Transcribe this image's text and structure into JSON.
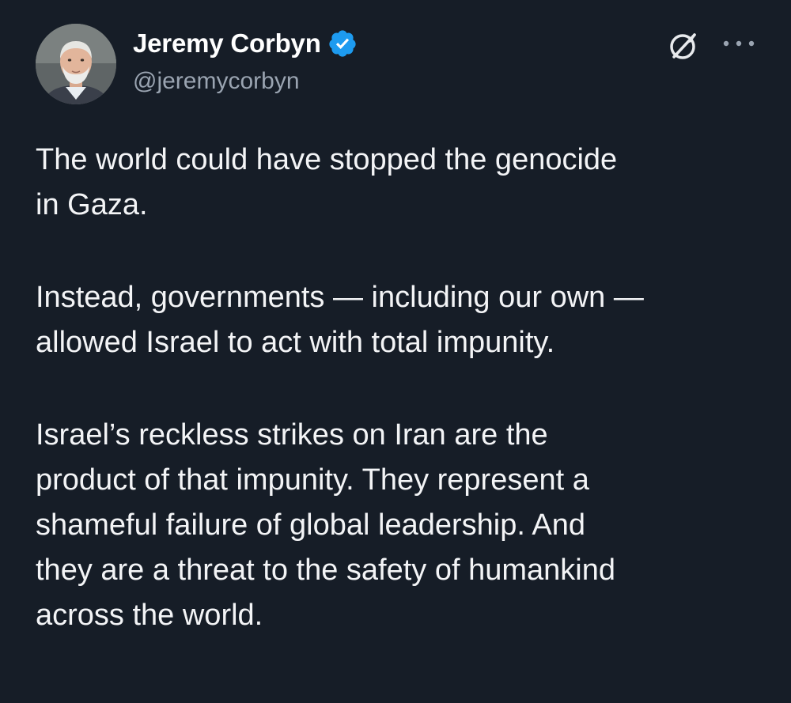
{
  "author": {
    "display_name": "Jeremy Corbyn",
    "handle": "@jeremycorbyn",
    "verified": true
  },
  "icons": {
    "verified": "verified-badge-icon",
    "grok": "grok-icon",
    "more": "more-options-icon"
  },
  "colors": {
    "background": "#161d27",
    "text": "#f3f4f6",
    "muted": "#9aa4b1",
    "verified_blue": "#1d9bf0"
  },
  "post": {
    "paragraphs": [
      "The world could have stopped the genocide\nin Gaza.",
      "Instead, governments — including our own —\nallowed Israel to act with total impunity.",
      "Israel’s reckless strikes on Iran are the\nproduct of that impunity. They represent a\nshameful failure of global leadership. And\nthey are a threat to the safety of humankind\nacross the world."
    ]
  }
}
